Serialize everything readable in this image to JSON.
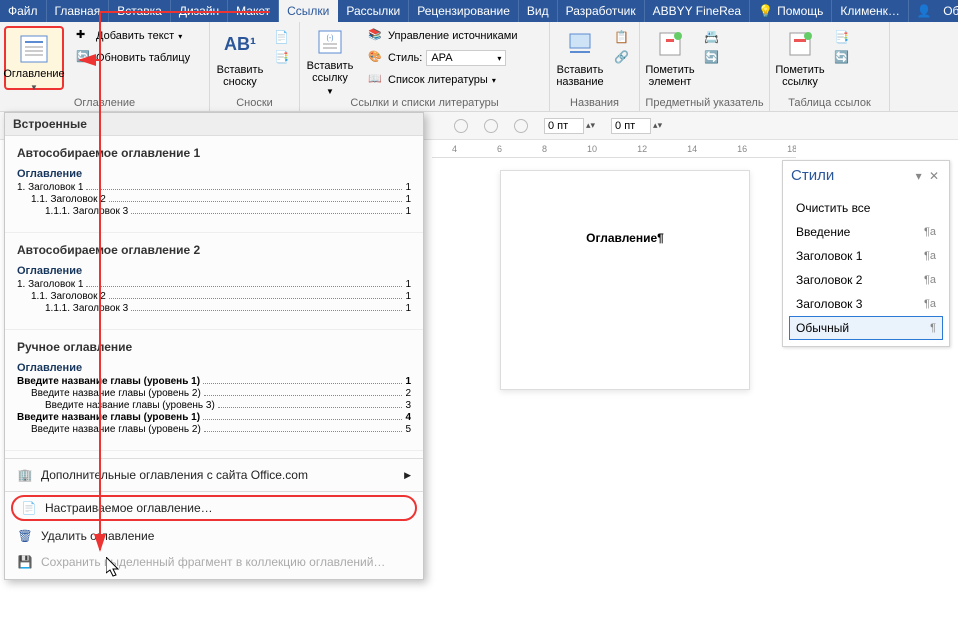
{
  "tabs": {
    "file": "Файл",
    "home": "Главная",
    "insert": "Вставка",
    "design": "Дизайн",
    "layout": "Макет",
    "references": "Ссылки",
    "mailings": "Рассылки",
    "review": "Рецензирование",
    "view": "Вид",
    "developer": "Разработчик",
    "abbyy": "ABBYY FineRea",
    "tell_me": "Помощь",
    "user": "Клименк…",
    "share": "Общий доступ"
  },
  "ribbon": {
    "toc_btn": "Оглавление",
    "add_text": "Добавить текст",
    "update_table": "Обновить таблицу",
    "group_toc": "Оглавление",
    "insert_footnote": "Вставить сноску",
    "group_footnotes": "Сноски",
    "insert_citation": "Вставить ссылку",
    "manage_sources": "Управление источниками",
    "style_lbl": "Стиль:",
    "style_val": "APA",
    "bibliography": "Список литературы",
    "group_citations": "Ссылки и списки литературы",
    "insert_caption": "Вставить название",
    "group_captions": "Названия",
    "mark_entry": "Пометить элемент",
    "group_index": "Предметный указатель",
    "mark_citation": "Пометить ссылку",
    "group_toa": "Таблица ссылок"
  },
  "subbar": {
    "pt1": "0 пт",
    "pt2": "0 пт"
  },
  "ruler_marks": [
    "4",
    "6",
    "8",
    "10",
    "12",
    "14",
    "16",
    "18"
  ],
  "gallery": {
    "hdr": "Встроенные",
    "auto1": {
      "title": "Автособираемое оглавление 1",
      "toc_title": "Оглавление",
      "rows": [
        {
          "lbl": "1.    Заголовок 1",
          "pg": "1",
          "indent": 0
        },
        {
          "lbl": "1.1.    Заголовок 2",
          "pg": "1",
          "indent": 1
        },
        {
          "lbl": "1.1.1.    Заголовок 3",
          "pg": "1",
          "indent": 2
        }
      ]
    },
    "auto2": {
      "title": "Автособираемое оглавление 2",
      "toc_title": "Оглавление",
      "rows": [
        {
          "lbl": "1.    Заголовок 1",
          "pg": "1",
          "indent": 0
        },
        {
          "lbl": "1.1.    Заголовок 2",
          "pg": "1",
          "indent": 1
        },
        {
          "lbl": "1.1.1.    Заголовок 3",
          "pg": "1",
          "indent": 2
        }
      ]
    },
    "manual": {
      "title": "Ручное оглавление",
      "toc_title": "Оглавление",
      "rows": [
        {
          "lbl": "Введите название главы (уровень 1)",
          "pg": "1",
          "indent": 0,
          "bold": true
        },
        {
          "lbl": "Введите название главы (уровень 2)",
          "pg": "2",
          "indent": 1
        },
        {
          "lbl": "Введите название главы (уровень 3)",
          "pg": "3",
          "indent": 2
        },
        {
          "lbl": "Введите название главы (уровень 1)",
          "pg": "4",
          "indent": 0,
          "bold": true
        },
        {
          "lbl": "Введите название главы (уровень 2)",
          "pg": "5",
          "indent": 1
        }
      ]
    },
    "more": "Дополнительные оглавления с сайта Office.com",
    "custom": "Настраиваемое оглавление…",
    "remove": "Удалить оглавление",
    "save_sel": "Сохранить выделенный фрагмент в коллекцию оглавлений…"
  },
  "doc": {
    "heading": "Оглавление¶"
  },
  "styles": {
    "title": "Стили",
    "items": [
      {
        "name": "Очистить все",
        "mark": ""
      },
      {
        "name": "Введение",
        "mark": "¶a"
      },
      {
        "name": "Заголовок 1",
        "mark": "¶a"
      },
      {
        "name": "Заголовок 2",
        "mark": "¶a"
      },
      {
        "name": "Заголовок 3",
        "mark": "¶a"
      },
      {
        "name": "Обычный",
        "mark": "¶",
        "selected": true
      }
    ]
  }
}
